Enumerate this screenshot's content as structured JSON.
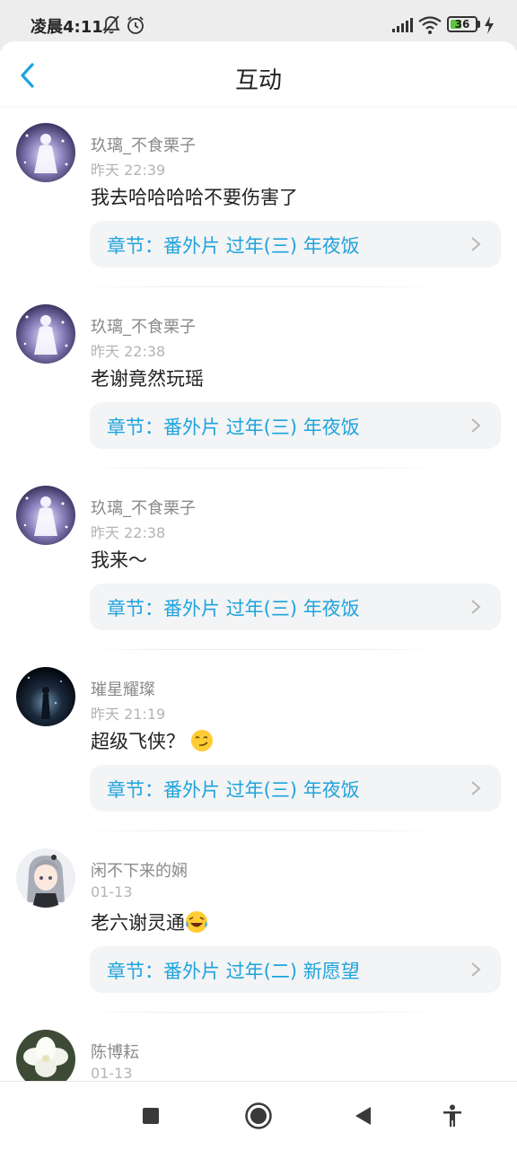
{
  "status_bar": {
    "time": "凌晨4:11",
    "icons": [
      "mute-bell-icon",
      "alarm-icon",
      "signal-icon",
      "wifi-icon",
      "battery-icon",
      "charging-icon"
    ],
    "battery": "36"
  },
  "header": {
    "title": "互动",
    "back_icon": "back-arrow-icon"
  },
  "colors": {
    "accent": "#1fa3dd",
    "chapter_bg": "#f3f4f5",
    "username": "#8a8a8a",
    "time": "#b4b4b4"
  },
  "feed": [
    {
      "user": "玖璃_不食栗子",
      "time": "昨天 22:39",
      "comment": "我去哈哈哈哈不要伤害了",
      "chapter": "章节：番外片 过年(三) 年夜饭"
    },
    {
      "user": "玖璃_不食栗子",
      "time": "昨天 22:38",
      "comment": "老谢竟然玩瑶",
      "chapter": "章节：番外片 过年(三) 年夜饭"
    },
    {
      "user": "玖璃_不食栗子",
      "time": "昨天 22:38",
      "comment": "我来～",
      "chapter": "章节：番外片 过年(三) 年夜饭"
    },
    {
      "user": "璀星耀璨",
      "time": "昨天 21:19",
      "comment": "超级飞侠？",
      "emoji": "smirk-face-icon",
      "chapter": "章节：番外片 过年(三) 年夜饭"
    },
    {
      "user": "闲不下来的娴",
      "time": "01-13",
      "comment": "老六谢灵通",
      "emoji": "laughing-tears-icon",
      "chapter": "章节：番外片 过年(二) 新愿望"
    },
    {
      "user": "陈博耘",
      "time": "01-13"
    }
  ],
  "nav_bar": {
    "buttons": [
      "recents-square-icon",
      "home-circle-icon",
      "back-triangle-icon",
      "accessibility-icon"
    ]
  }
}
